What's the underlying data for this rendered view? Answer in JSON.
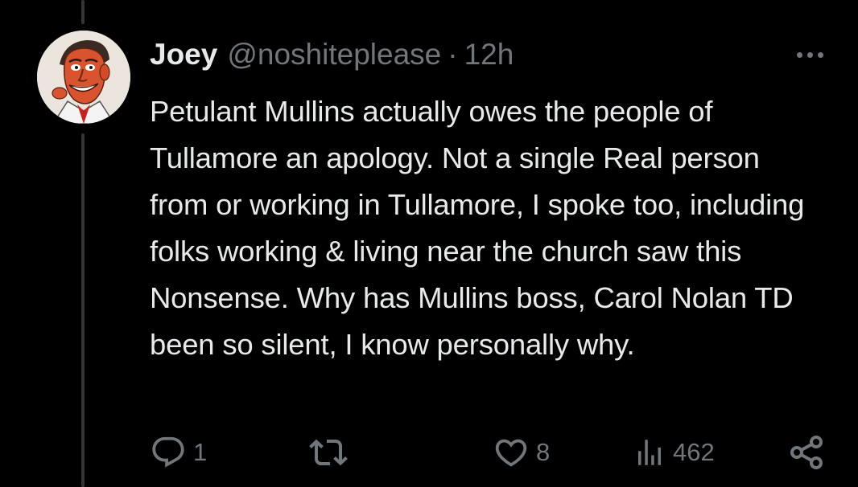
{
  "tweet": {
    "display_name": "Joey",
    "handle": "@noshiteplease",
    "separator": "·",
    "time": "12h",
    "text": "Petulant Mullins actually owes the people of Tullamore an apology. Not a single Real person from or working in Tullamore, I spoke too, including folks working & living near the church saw this Nonsense. Why has Mullins boss, Carol Nolan TD been so silent, I know personally why.",
    "avatar_icon": "caricature-avatar"
  },
  "actions": {
    "reply": {
      "icon": "reply-icon",
      "count": "1"
    },
    "retweet": {
      "icon": "retweet-icon",
      "count": ""
    },
    "like": {
      "icon": "heart-icon",
      "count": "8"
    },
    "views": {
      "icon": "views-icon",
      "count": "462"
    },
    "share": {
      "icon": "share-icon"
    },
    "more": {
      "icon": "more-icon"
    }
  },
  "colors": {
    "background": "#000000",
    "primary_text": "#e7e9ea",
    "secondary_text": "#71767b",
    "thread_line": "#333639"
  }
}
